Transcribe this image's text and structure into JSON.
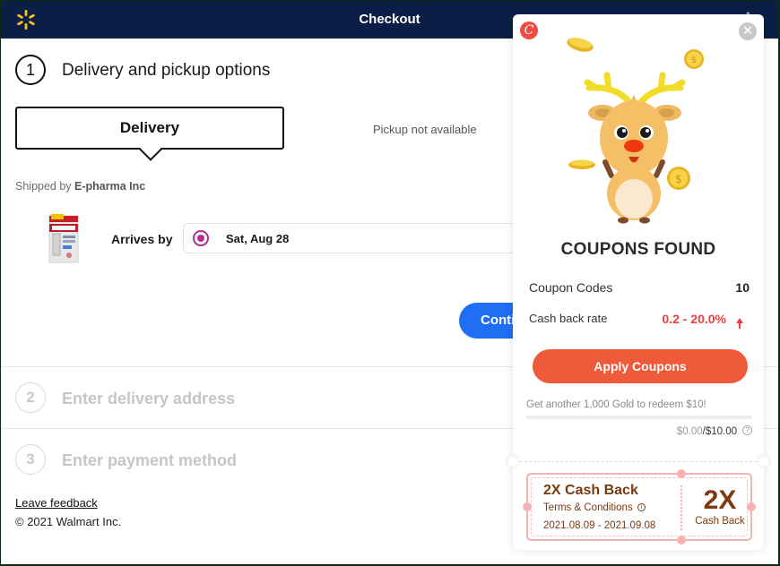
{
  "header": {
    "title": "Checkout",
    "logo": "walmart-spark-icon",
    "right_glyph": "1"
  },
  "step1": {
    "number": "1",
    "title": "Delivery and pickup options",
    "delivery_tab": "Delivery",
    "pickup_status": "Pickup not available",
    "shipped_by_prefix": "Shipped by ",
    "shipped_by_seller": "E-pharma Inc",
    "product_image": "Kerasal product box",
    "arrives_label": "Arrives by",
    "arrival_date": "Sat, Aug 28",
    "continue_label": "Continue"
  },
  "step2": {
    "number": "2",
    "title": "Enter delivery address"
  },
  "step3": {
    "number": "3",
    "title": "Enter payment method"
  },
  "footer": {
    "feedback_link": "Leave feedback",
    "copyright": "© 2021 Walmart Inc."
  },
  "coupon_popup": {
    "logo_letter": "C",
    "close_glyph": "✕",
    "title": "COUPONS FOUND",
    "coupon_codes_label": "Coupon Codes",
    "coupon_codes_count": "10",
    "cashback_label": "Cash back rate",
    "cashback_rate": "0.2 - 20.0%",
    "apply_button": "Apply Coupons",
    "gold_message": "Get another 1,000 Gold to redeem $10!",
    "gold_progress": 0.0,
    "gold_current": "$0.00",
    "gold_separator": "/",
    "gold_target": "$10.00",
    "help_glyph": "?",
    "ticket": {
      "title": "2X Cash Back",
      "terms": "Terms & Conditions",
      "info_glyph": "i",
      "dates": "2021.08.09 - 2021.09.08",
      "big": "2X",
      "small": "Cash Back"
    },
    "colors": {
      "accent": "#ef5a3b",
      "rate": "#ef3f3f",
      "ticket_text": "#7b3a10",
      "ticket_border": "#f5b3b3"
    }
  },
  "colors": {
    "header_bg": "#0b1e45",
    "spark": "#ffc220",
    "continue_bg": "#1f6ef3",
    "radio": "#b42c8e"
  }
}
